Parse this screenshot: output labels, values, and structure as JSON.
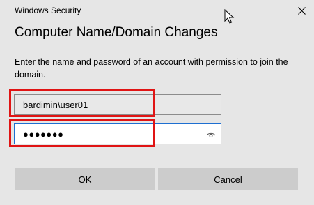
{
  "window": {
    "app_title": "Windows Security",
    "close_symbol": "✕"
  },
  "dialog": {
    "title": "Computer Name/Domain Changes",
    "message": "Enter the name and password of an account with permission to join the domain."
  },
  "form": {
    "username_value": "bardimin\\user01",
    "password_masked": "●●●●●●●",
    "password_reveal_icon": "eye-icon"
  },
  "buttons": {
    "ok_label": "OK",
    "cancel_label": "Cancel"
  },
  "colors": {
    "background": "#e6e6e6",
    "highlight": "#e01414",
    "focus_border": "#1e6fd1",
    "button": "#cccccc"
  }
}
